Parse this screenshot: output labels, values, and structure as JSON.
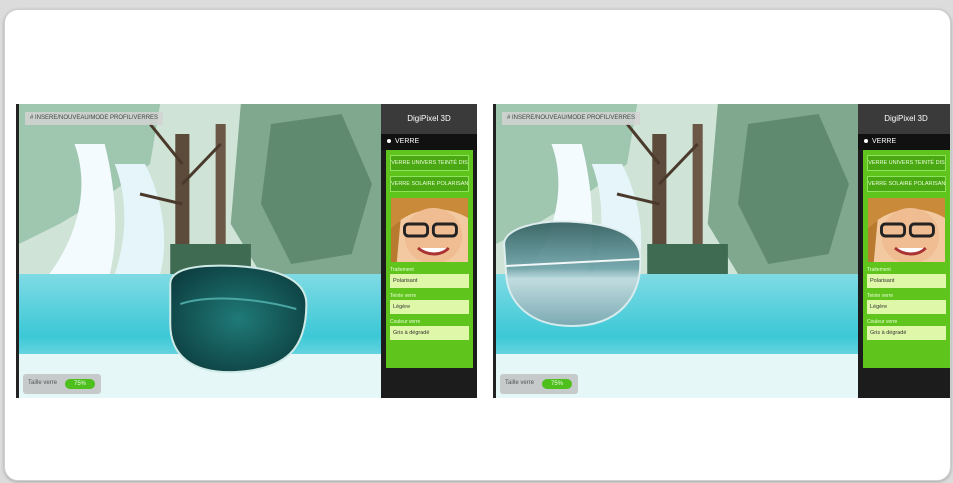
{
  "screens": [
    {
      "breadcrumb": "# INSERE/NOUVEAU/MODE PROFIL/VERRES",
      "size_label": "Taille verre",
      "size_value": "75%",
      "panel": {
        "title": "DigiPixel 3D",
        "menu_label": "VERRE",
        "buttons": [
          "VERRE UNIVERS TEINTÉ DIS",
          "VERRE SOLAIRE POLARISANT"
        ],
        "fields": [
          {
            "label": "Traitement",
            "value": "Polarisant"
          },
          {
            "label": "Teinte verre",
            "value": "Légère"
          },
          {
            "label": "Couleur verre",
            "value": "Gris à dégradé"
          }
        ]
      }
    },
    {
      "breadcrumb": "# INSERE/NOUVEAU/MODE PROFIL/VERRES",
      "size_label": "Taille verre",
      "size_value": "75%",
      "panel": {
        "title": "DigiPixel 3D",
        "menu_label": "VERRE",
        "buttons": [
          "VERRE UNIVERS TEINTÉ DIS",
          "VERRE SOLAIRE POLARISANT"
        ],
        "fields": [
          {
            "label": "Traitement",
            "value": "Polarisant"
          },
          {
            "label": "Teinte verre",
            "value": "Légère"
          },
          {
            "label": "Couleur verre",
            "value": "Gris à dégradé"
          }
        ]
      }
    }
  ],
  "colors": {
    "panel_bg": "#1c1c1c",
    "panel_green": "#5fc41b",
    "lagoon": "#3cc8d6"
  },
  "icons": {
    "menu_bullet": "dot-icon",
    "lens": "lens-overlay"
  }
}
